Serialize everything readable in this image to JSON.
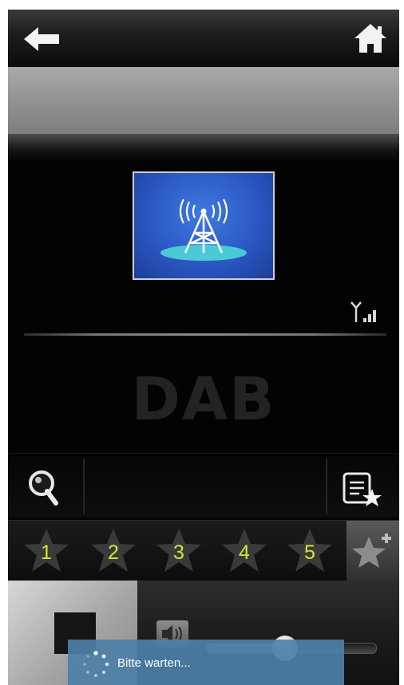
{
  "header": {
    "back_icon": "arrow-left-icon",
    "home_icon": "home-icon"
  },
  "station": {
    "name": "",
    "logo_icon": "broadcast-tower-icon",
    "signal_icon": "signal-strength-icon"
  },
  "display": {
    "mode_label": "DAB"
  },
  "actions": {
    "search_icon": "search-icon",
    "favorites_icon": "favorites-list-icon"
  },
  "presets": [
    {
      "label": "1"
    },
    {
      "label": "2"
    },
    {
      "label": "3"
    },
    {
      "label": "4"
    },
    {
      "label": "5"
    }
  ],
  "add_favorite_icon": "add-favorite-star-icon",
  "volume": {
    "icon": "speaker-icon",
    "level_fraction": 0.46
  },
  "toast": {
    "text": "Bitte warten..."
  },
  "colors": {
    "preset_number": "#d4e63a",
    "logo_blue": "#2b58c4",
    "toast_bg": "#4e80a8"
  }
}
